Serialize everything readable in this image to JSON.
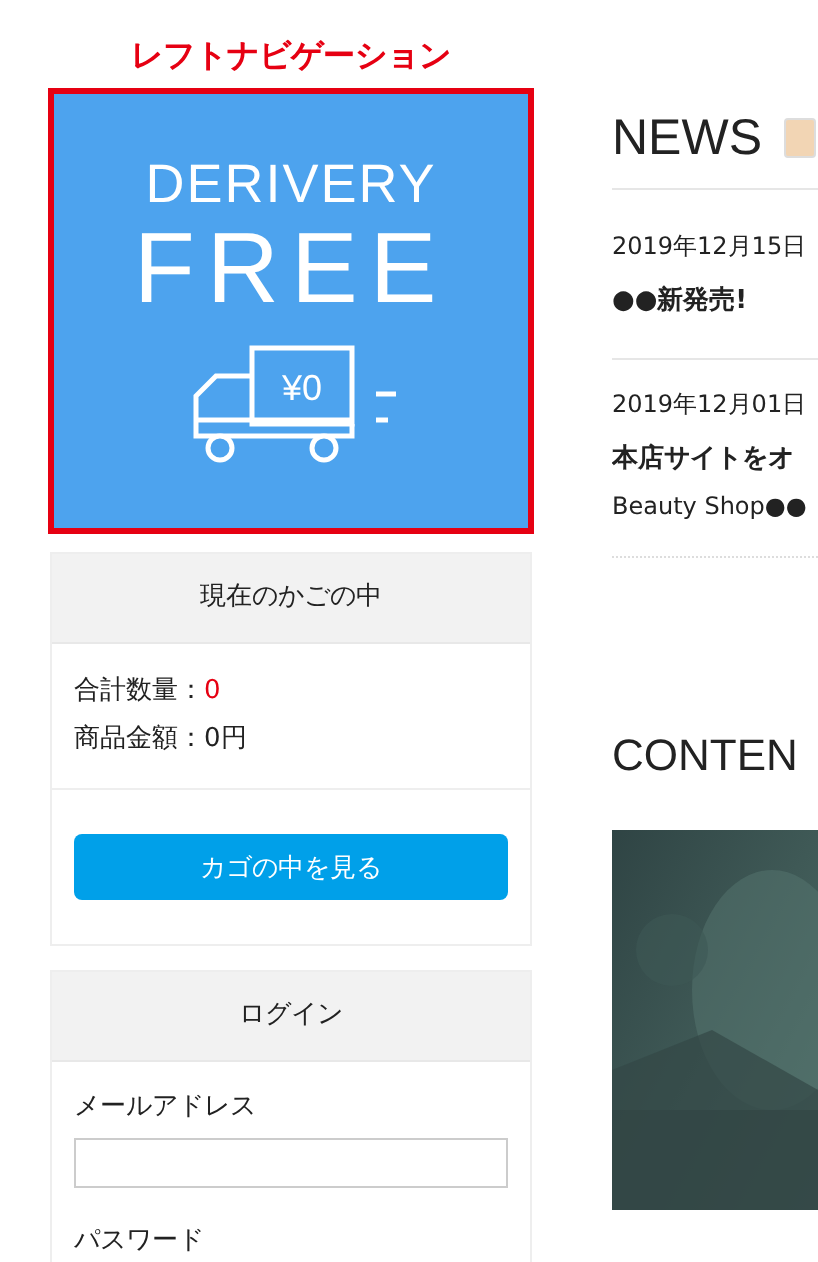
{
  "annotation": "レフトナビゲーション",
  "banner": {
    "line_1": "DERIVERY",
    "line_2": "FREE",
    "price": "¥0"
  },
  "cart": {
    "title": "現在のかごの中",
    "lines": [
      {
        "label": "合計数量：",
        "value": "0",
        "highlight": true
      },
      {
        "label": "商品金額：",
        "value": "0円",
        "highlight": false
      }
    ],
    "button": "カゴの中を見る"
  },
  "login": {
    "title": "ログイン",
    "fields": [
      {
        "label": "メールアドレス"
      },
      {
        "label": "パスワード"
      }
    ]
  },
  "news": {
    "heading": "NEWS",
    "items": [
      {
        "date": "2019年12月15日",
        "title": "●●新発売!"
      },
      {
        "date": "2019年12月01日",
        "title": "本店サイトをオ",
        "body": "Beauty Shop●●"
      }
    ]
  },
  "content": {
    "heading": "CONTEN"
  }
}
